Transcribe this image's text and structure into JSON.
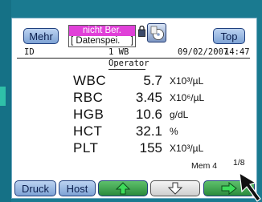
{
  "header": {
    "more_label": "Mehr",
    "top_label": "Top",
    "status_line1": "nicht Ber.",
    "status_line2": "[ Datenspei.",
    "status_bracket": "]"
  },
  "info": {
    "id_label": "ID",
    "sample": "1 WB",
    "date": "09/02/2007",
    "time": "14:47",
    "operator_label": "Operator"
  },
  "results": [
    {
      "name": "WBC",
      "value": "5.7",
      "unit": "X10³/µL"
    },
    {
      "name": "RBC",
      "value": "3.45",
      "unit": "X10⁶/µL"
    },
    {
      "name": "HGB",
      "value": "10.6",
      "unit": "g/dL"
    },
    {
      "name": "HCT",
      "value": "32.1",
      "unit": "%"
    },
    {
      "name": "PLT",
      "value": "155",
      "unit": "X10³/µL"
    }
  ],
  "footer": {
    "mem": "Mem 4",
    "page": "1/8"
  },
  "toolbar": {
    "druck_label": "Druck",
    "host_label": "Host",
    "up_icon": "arrow-up-icon",
    "down_icon": "arrow-down-icon",
    "right_icon": "arrow-right-icon"
  },
  "colors": {
    "status_highlight": "#e040d8",
    "button_blue": "#7ea3d5",
    "button_green": "#2b8a3c",
    "device_background": "#1a7a90"
  }
}
